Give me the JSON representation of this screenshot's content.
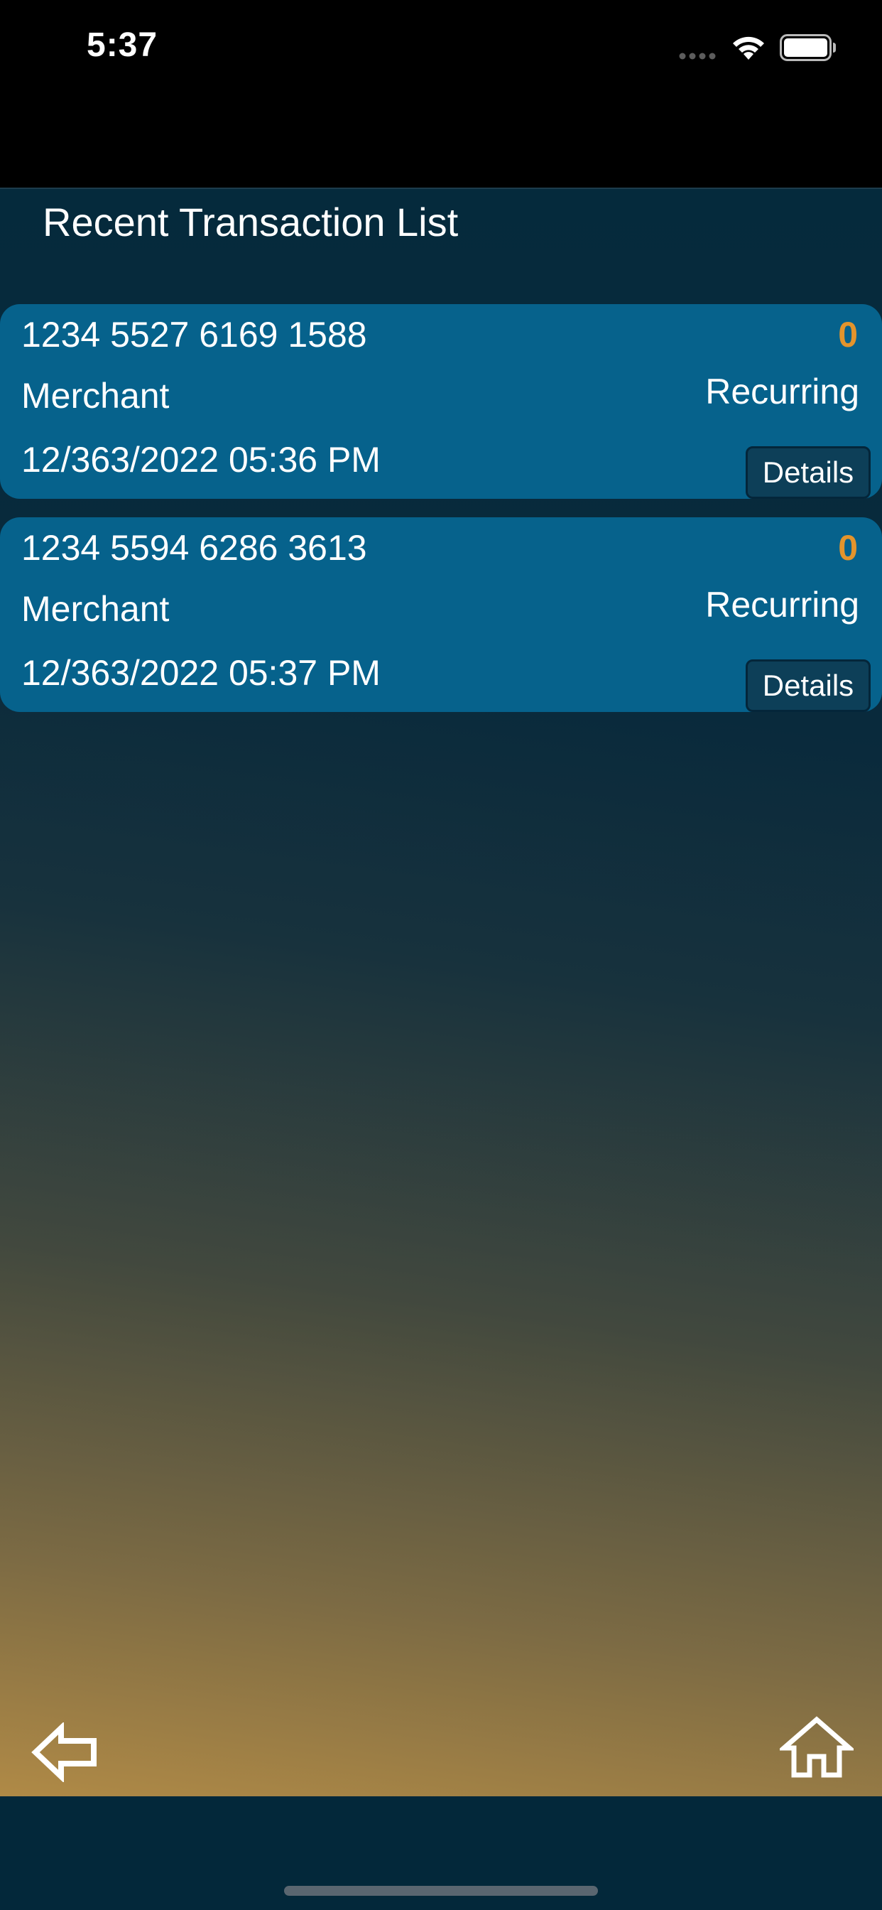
{
  "status_bar": {
    "time": "5:37",
    "icons": [
      "signal-dots-icon",
      "wifi-icon",
      "battery-icon"
    ]
  },
  "page": {
    "title": "Recent Transaction List"
  },
  "transactions": [
    {
      "card_number": "1234 5527 6169 1588",
      "amount": "0",
      "merchant": "Merchant",
      "type": "Recurring",
      "date": "12/363/2022 05:36 PM",
      "details_label": "Details"
    },
    {
      "card_number": "1234 5594 6286 3613",
      "amount": "0",
      "merchant": "Merchant",
      "type": "Recurring",
      "date": "12/363/2022 05:37 PM",
      "details_label": "Details"
    }
  ],
  "nav": {
    "back_icon": "back-arrow-icon",
    "home_icon": "home-icon"
  },
  "colors": {
    "card_background": "#06628c",
    "amount_accent": "#e3942c",
    "details_button": "#0d3f58",
    "gradient_warm": "#b08a46",
    "gradient_dark": "#0a2a3c"
  }
}
